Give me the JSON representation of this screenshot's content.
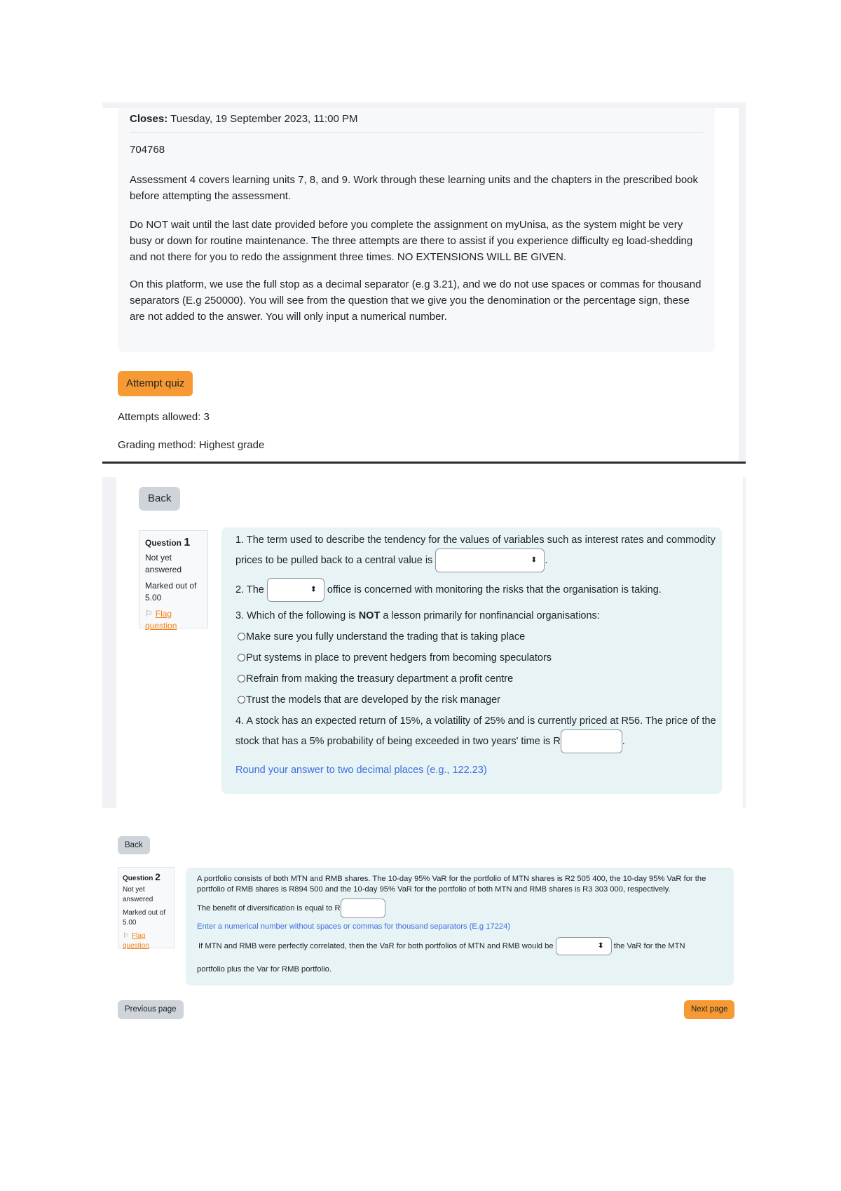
{
  "quiz_info": {
    "closes_label": "Closes:",
    "closes_value": "Tuesday, 19 September 2023, 11:00 PM",
    "code": "704768",
    "paragraphs": [
      "Assessment 4 covers learning units 7, 8, and 9. Work through these learning units and the chapters in the prescribed book before attempting the assessment.",
      "Do NOT wait until the last date provided before you complete the assignment on myUnisa, as the system might be very busy or down for routine maintenance. The three attempts are there to assist if you experience difficulty eg load-shedding and not there for you to redo the assignment three times. NO EXTENSIONS WILL BE GIVEN.",
      "On this platform, we use the full stop as a decimal separator (e.g 3.21), and we do not use spaces or commas for thousand separators (E.g 250000). You will see from the question that we give you the denomination or the percentage sign, these are not added to the answer. You will only input a numerical number."
    ],
    "attempt_button": "Attempt quiz",
    "attempts_allowed": "Attempts allowed: 3",
    "grading_method": "Grading method: Highest grade"
  },
  "question1": {
    "back_button": "Back",
    "info": {
      "label": "Question",
      "number": "1",
      "status": "Not yet answered",
      "marked": "Marked out of 5.00",
      "flag": "Flag question"
    },
    "part1_line1": "1. The term used to describe the tendency for the values of variables such as interest rates and commodity",
    "part1_line2": "prices to be pulled back to a central value is",
    "part1_select_value": "",
    "part1_end": ".",
    "part2_pre": "2. The",
    "part2_select_value": "",
    "part2_post": "office is concerned with monitoring the risks that the organisation is taking.",
    "part3_pre": "3. Which of the following is",
    "part3_bold": "NOT",
    "part3_post": "a lesson primarily for nonfinancial organisations:",
    "part3_options": [
      "Make sure you fully understand the trading that is taking place",
      "Put systems in place to prevent hedgers from becoming speculators",
      "Refrain from making the treasury department a profit centre",
      "Trust the models that are developed by the risk manager"
    ],
    "part4_line1": "4. A stock has an expected return of 15%, a volatility of 25% and is currently priced at R56. The price of the",
    "part4_line2": "stock that has a 5% probability of being exceeded in two years' time is R",
    "part4_input_value": "",
    "part4_end": ".",
    "hint": "Round your answer to two decimal places (e.g., 122.23)"
  },
  "question2": {
    "back_button": "Back",
    "info": {
      "label": "Question",
      "number": "2",
      "status": "Not yet answered",
      "marked": "Marked out of 5.00",
      "flag": "Flag question"
    },
    "stem_line1": "A portfolio consists of both MTN and RMB shares. The 10-day 95% VaR for the portfolio of MTN shares is R2 505 400, the 10-day 95% VaR for the",
    "stem_line2": "portfolio of RMB shares is R894 500 and the 10-day 95% VaR for the portfolio of both MTN and RMB shares is R3 303 000, respectively.",
    "benefit_pre": "The benefit of diversification is equal to R",
    "benefit_input_value": "",
    "hint": "Enter a numerical number without spaces or commas for thousand separators (E.g 17224)",
    "corr_pre": "If MTN and RMB were perfectly correlated, then the VaR for both portfolios of MTN and RMB would be",
    "corr_select_value": "",
    "corr_post": "the VaR for the MTN",
    "corr_line2": "portfolio plus the Var for RMB portfolio."
  },
  "navigation": {
    "previous": "Previous page",
    "next": "Next page"
  },
  "colors": {
    "accent_orange": "#f79a34",
    "hint_blue": "#3b6fe0",
    "question_bg": "#e7f3f5"
  }
}
